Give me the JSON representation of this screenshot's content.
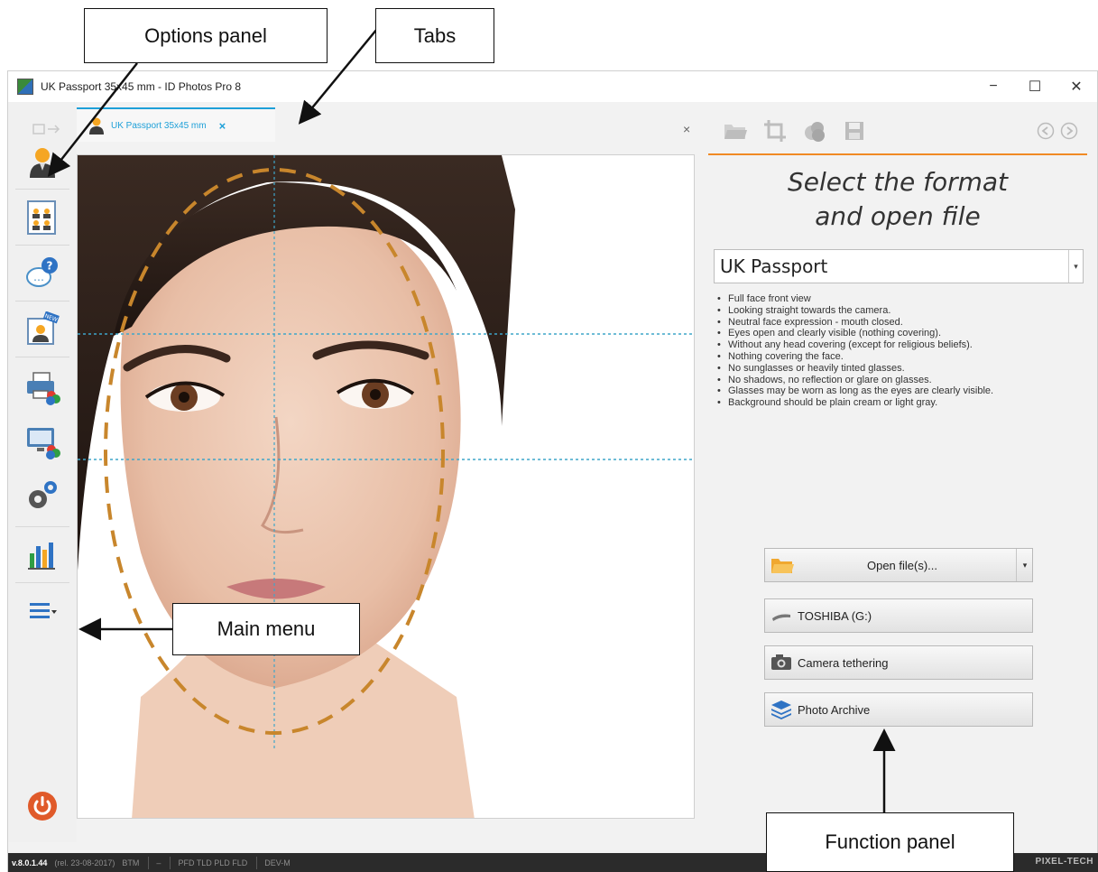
{
  "window": {
    "title": "UK Passport 35x45 mm - ID Photos Pro 8",
    "controls": {
      "minimize": "−",
      "maximize": "☐",
      "close": "✕"
    }
  },
  "tabs": {
    "active_label": "UK Passport 35x45 mm",
    "active_close": "×",
    "close_all": "×",
    "accent_color": "#1ea0d8"
  },
  "sidebar": {
    "items": [
      {
        "name": "options-panel",
        "icon": "person-icon"
      },
      {
        "name": "layout",
        "icon": "group-sheet-icon"
      },
      {
        "name": "help",
        "icon": "help-bubble-icon"
      },
      {
        "name": "whats-new",
        "icon": "new-photo-icon"
      },
      {
        "name": "print",
        "icon": "printer-color-icon"
      },
      {
        "name": "display",
        "icon": "monitor-color-icon"
      },
      {
        "name": "settings",
        "icon": "gears-icon"
      },
      {
        "name": "statistics",
        "icon": "bar-chart-icon"
      },
      {
        "name": "main-menu",
        "icon": "hamburger-menu-icon"
      },
      {
        "name": "exit",
        "icon": "power-icon"
      }
    ]
  },
  "right_panel": {
    "toolbar_icons": [
      "open-folder-icon",
      "crop-icon",
      "color-adjust-icon",
      "save-icon",
      "back-icon",
      "forward-icon"
    ],
    "accent_color": "#f08a24",
    "heading_line1": "Select the format",
    "heading_line2": "and open file",
    "format_selected": "UK Passport",
    "requirements": [
      "Full face front view",
      "Looking straight towards the camera.",
      "Neutral face expression - mouth closed.",
      "Eyes open and clearly visible (nothing covering).",
      "Without any head covering (except for religious beliefs).",
      "Nothing covering the face.",
      "No sunglasses or heavily tinted glasses.",
      "No shadows, no reflection or glare on glasses.",
      "Glasses may be worn as long as the eyes are clearly visible.",
      "Background should be plain cream or light gray."
    ],
    "buttons": {
      "open_files": "Open file(s)...",
      "drive": "TOSHIBA (G:)",
      "camera": "Camera tethering",
      "archive": "Photo Archive"
    }
  },
  "statusbar": {
    "version": "v.8.0.1.44",
    "release": "(rel. 23-08-2017)",
    "edition": "BTM",
    "dash": "–",
    "flags": "PFD TLD PLD FLD",
    "mode": "DEV-M",
    "brand": "PIXEL-TECH"
  },
  "annotations": {
    "options_panel": "Options panel",
    "tabs": "Tabs",
    "main_menu": "Main menu",
    "function_panel": "Function panel"
  },
  "guide_color": "#c8862c"
}
